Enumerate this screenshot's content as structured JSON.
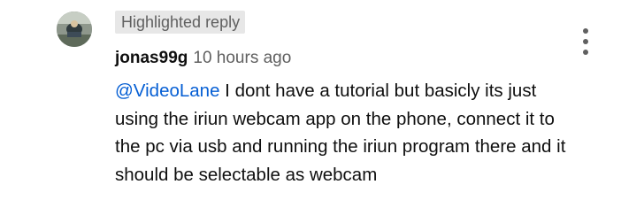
{
  "comment": {
    "badge": "Highlighted reply",
    "author": "jonas99g",
    "timestamp": "10 hours ago",
    "mention": "@VideoLane",
    "text": " I dont have a tutorial but basicly its just using the iriun webcam app on the phone, connect it to the pc via usb and running the iriun program there and it should be selectable as webcam",
    "avatar_icon": "user-avatar-photo",
    "menu_icon": "more-vertical-icon",
    "colors": {
      "mention": "#065fd4",
      "secondary_text": "#606060",
      "badge_bg": "#e7e7e7"
    }
  }
}
